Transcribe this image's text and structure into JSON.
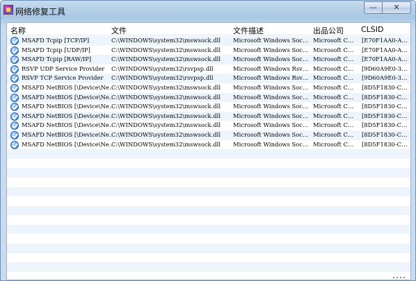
{
  "window": {
    "title": "网络修复工具",
    "minimize_label": "—",
    "close_label": "✕"
  },
  "columns": {
    "name": "名称",
    "file": "文件",
    "description": "文件描述",
    "company": "出品公司",
    "clsid": "CLSID"
  },
  "rows": [
    {
      "name": "MSAFD Tcpip [TCP/IP]",
      "file": "C:\\WINDOWS\\system32\\mswsock.dll",
      "description": "Microsoft Windows Soc…",
      "company": "Microsoft C…",
      "clsid": "[E70F1AA0-A…"
    },
    {
      "name": "MSAFD Tcpip [UDP/IP]",
      "file": "C:\\WINDOWS\\system32\\mswsock.dll",
      "description": "Microsoft Windows Soc…",
      "company": "Microsoft C…",
      "clsid": "[E70F1AA0-A…"
    },
    {
      "name": "MSAFD Tcpip [RAW/IP]",
      "file": "C:\\WINDOWS\\system32\\mswsock.dll",
      "description": "Microsoft Windows Soc…",
      "company": "Microsoft C…",
      "clsid": "[E70F1AA0-A…"
    },
    {
      "name": "RSVP UDP Service Provider",
      "file": "C:\\WINDOWS\\system32\\rsvpsp.dll",
      "description": "Microsoft Windows Rsv…",
      "company": "Microsoft C…",
      "clsid": "[9D60A9E0-3…"
    },
    {
      "name": "RSVP TCP Service Provider",
      "file": "C:\\WINDOWS\\system32\\rsvpsp.dll",
      "description": "Microsoft Windows Rsv…",
      "company": "Microsoft C…",
      "clsid": "[9D60A9E0-3…"
    },
    {
      "name": "MSAFD NetBIOS [\\Device\\Ne…",
      "file": "C:\\WINDOWS\\system32\\mswsock.dll",
      "description": "Microsoft Windows Soc…",
      "company": "Microsoft C…",
      "clsid": "[8D5F1830-C…"
    },
    {
      "name": "MSAFD NetBIOS [\\Device\\Ne…",
      "file": "C:\\WINDOWS\\system32\\mswsock.dll",
      "description": "Microsoft Windows Soc…",
      "company": "Microsoft C…",
      "clsid": "[8D5F1830-C…"
    },
    {
      "name": "MSAFD NetBIOS [\\Device\\Ne…",
      "file": "C:\\WINDOWS\\system32\\mswsock.dll",
      "description": "Microsoft Windows Soc…",
      "company": "Microsoft C…",
      "clsid": "[8D5F1830-C…"
    },
    {
      "name": "MSAFD NetBIOS [\\Device\\Ne…",
      "file": "C:\\WINDOWS\\system32\\mswsock.dll",
      "description": "Microsoft Windows Soc…",
      "company": "Microsoft C…",
      "clsid": "[8D5F1830-C…"
    },
    {
      "name": "MSAFD NetBIOS [\\Device\\Ne…",
      "file": "C:\\WINDOWS\\system32\\mswsock.dll",
      "description": "Microsoft Windows Soc…",
      "company": "Microsoft C…",
      "clsid": "[8D5F1830-C…"
    },
    {
      "name": "MSAFD NetBIOS [\\Device\\Ne…",
      "file": "C:\\WINDOWS\\system32\\mswsock.dll",
      "description": "Microsoft Windows Soc…",
      "company": "Microsoft C…",
      "clsid": "[8D5F1830-C…"
    },
    {
      "name": "MSAFD NetBIOS [\\Device\\Ne…",
      "file": "C:\\WINDOWS\\system32\\mswsock.dll",
      "description": "Microsoft Windows Soc…",
      "company": "Microsoft C…",
      "clsid": "[8D5F1830-C…"
    }
  ],
  "icons": {
    "app": "network-repair-app-icon",
    "row": "check-shield-icon"
  },
  "colors": {
    "titlebar": "#b5cfe8",
    "row_alt": "#eef4fc",
    "icon_blue": "#2f74c8"
  }
}
